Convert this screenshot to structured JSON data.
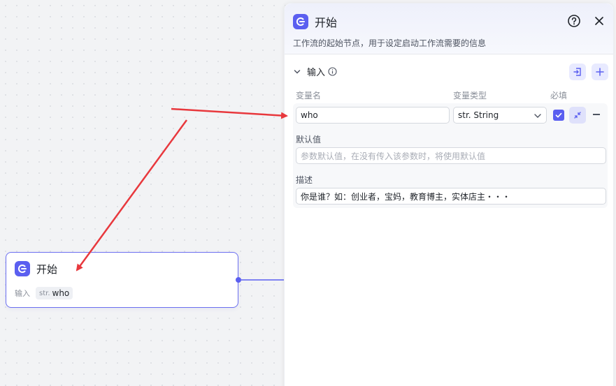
{
  "node": {
    "title": "开始",
    "io_label": "输入",
    "var_type": "str.",
    "var_name": "who"
  },
  "panel": {
    "title": "开始",
    "description": "工作流的起始节点，用于设定启动工作流需要的信息",
    "section_title": "输入",
    "columns": {
      "name": "变量名",
      "type": "变量类型",
      "required": "必填"
    },
    "variable": {
      "name_value": "who",
      "type_value": "str. String",
      "required": true,
      "default_label": "默认值",
      "default_placeholder": "参数默认值，在没有传入该参数时，将使用默认值",
      "desc_label": "描述",
      "desc_value": "你是谁？如：创业者，宝妈，教育博主，实体店主・・・"
    }
  },
  "colors": {
    "accent": "#5b5ff0",
    "annotation_arrow": "#e8383d"
  },
  "icons": [
    "start-icon",
    "help-icon",
    "close-icon",
    "chevron-down-icon",
    "info-icon",
    "import-icon",
    "plus-icon",
    "check-icon",
    "collapse-icon",
    "minus-icon"
  ]
}
